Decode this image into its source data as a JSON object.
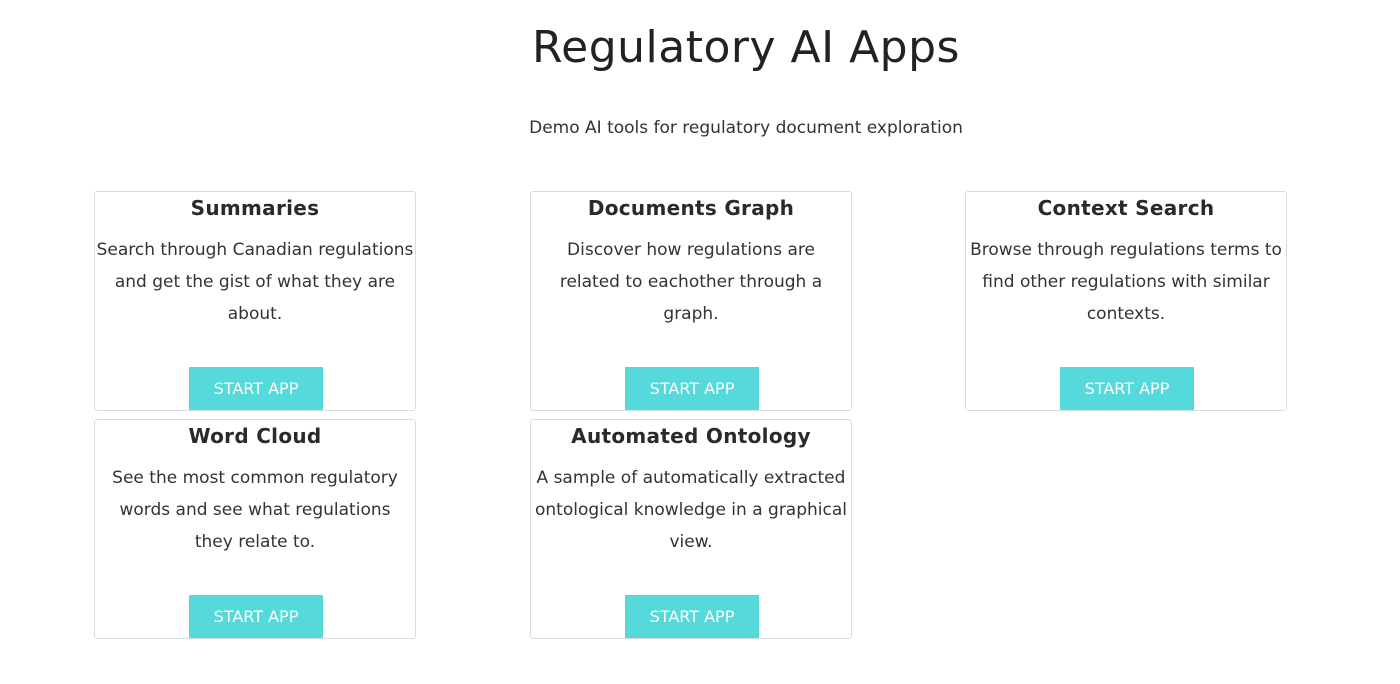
{
  "header": {
    "title": "Regulatory AI Apps",
    "subtitle": "Demo AI tools for regulatory document exploration"
  },
  "colors": {
    "accent": "#55d9da"
  },
  "apps": [
    {
      "title": "Summaries",
      "description": "Search through Canadian regulations and get the gist of what they are about.",
      "button": "START APP"
    },
    {
      "title": "Documents Graph",
      "description": "Discover how regulations are related to eachother through a graph.",
      "button": "START APP"
    },
    {
      "title": "Context Search",
      "description": "Browse through regulations terms to find other regulations with similar contexts.",
      "button": "START APP"
    },
    {
      "title": "Word Cloud",
      "description": "See the most common regulatory words and see what regulations they relate to.",
      "button": "START APP"
    },
    {
      "title": "Automated Ontology",
      "description": "A sample of automatically extracted ontological knowledge in a graphical view.",
      "button": "START APP"
    }
  ]
}
